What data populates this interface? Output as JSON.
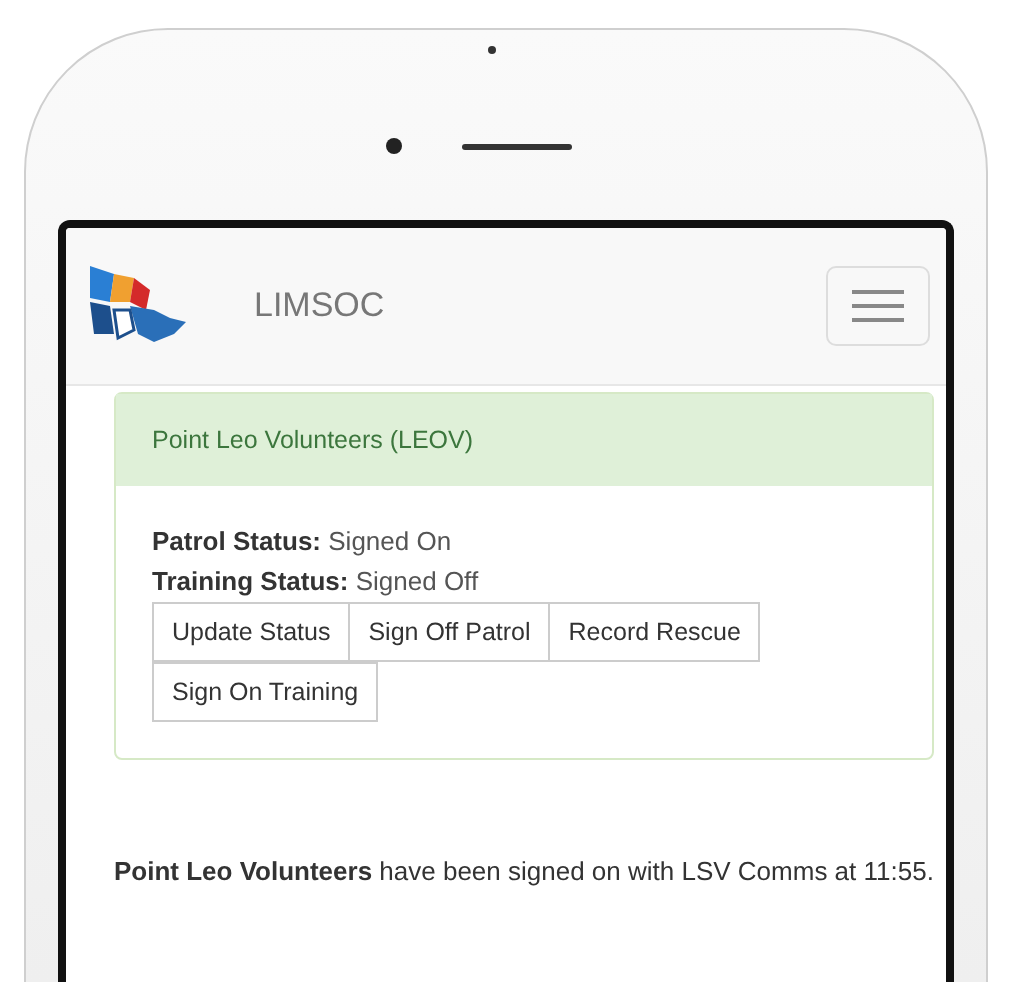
{
  "navbar": {
    "brand": "LIMSOC"
  },
  "panel": {
    "heading": "Point Leo Volunteers (LEOV)",
    "statuses": [
      {
        "label": "Patrol Status:",
        "value": "Signed On"
      },
      {
        "label": "Training Status:",
        "value": "Signed Off"
      }
    ],
    "buttons": [
      "Update Status",
      "Sign Off Patrol",
      "Record Rescue",
      "Sign On Training"
    ]
  },
  "message": "**Point Leo Volunteers** have been signed on with LSV Comms at 11:55."
}
